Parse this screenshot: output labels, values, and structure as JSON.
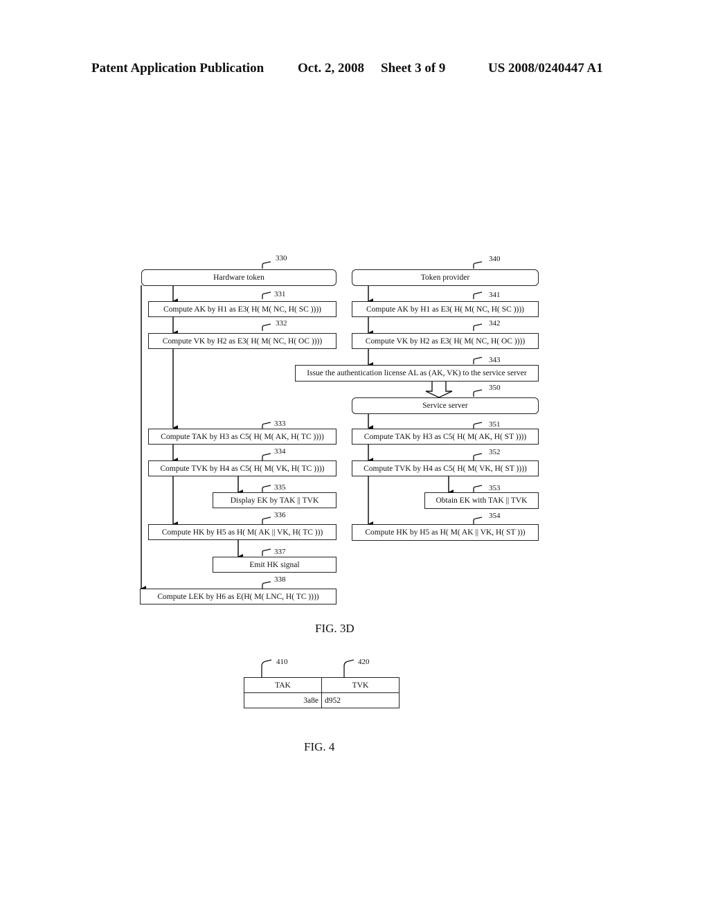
{
  "header": {
    "left": "Patent Application Publication",
    "date": "Oct. 2, 2008",
    "sheet": "Sheet 3 of 9",
    "number": "US 2008/0240447 A1"
  },
  "fig3d": {
    "caption": "FIG. 3D",
    "hardware_token": {
      "ref": "330",
      "label": "Hardware token"
    },
    "token_provider": {
      "ref": "340",
      "label": "Token provider"
    },
    "service_server": {
      "ref": "350",
      "label": "Service server"
    },
    "steps": {
      "s331": {
        "ref": "331",
        "label": "Compute AK by H1 as E3( H( M( NC, H( SC ))))"
      },
      "s332": {
        "ref": "332",
        "label": "Compute VK by H2 as E3( H( M( NC, H( OC ))))"
      },
      "s333": {
        "ref": "333",
        "label": "Compute TAK by H3 as C5( H( M( AK, H( TC ))))"
      },
      "s334": {
        "ref": "334",
        "label": "Compute TVK by H4 as C5( H( M( VK, H( TC ))))"
      },
      "s335": {
        "ref": "335",
        "label": "Display EK by TAK || TVK"
      },
      "s336": {
        "ref": "336",
        "label": "Compute HK by H5 as H( M( AK || VK, H( TC )))"
      },
      "s337": {
        "ref": "337",
        "label": "Emit HK signal"
      },
      "s338": {
        "ref": "338",
        "label": "Compute LEK by H6 as E(H( M( LNC, H( TC ))))"
      },
      "s341": {
        "ref": "341",
        "label": "Compute AK by H1 as E3( H( M( NC, H( SC ))))"
      },
      "s342": {
        "ref": "342",
        "label": "Compute VK by H2 as E3( H( M( NC, H( OC ))))"
      },
      "s343": {
        "ref": "343",
        "label": "Issue the authentication license AL as (AK, VK) to the service server"
      },
      "s351": {
        "ref": "351",
        "label": "Compute TAK by H3 as C5( H( M( AK, H( ST ))))"
      },
      "s352": {
        "ref": "352",
        "label": "Compute TVK by H4 as C5( H( M( VK, H( ST ))))"
      },
      "s353": {
        "ref": "353",
        "label": "Obtain EK with TAK || TVK"
      },
      "s354": {
        "ref": "354",
        "label": "Compute HK by H5 as H( M( AK || VK, H( ST )))"
      }
    }
  },
  "fig4": {
    "caption": "FIG. 4",
    "columns": [
      {
        "ref": "410",
        "header": "TAK",
        "value": "3a8e"
      },
      {
        "ref": "420",
        "header": "TVK",
        "value": "d952"
      }
    ]
  }
}
